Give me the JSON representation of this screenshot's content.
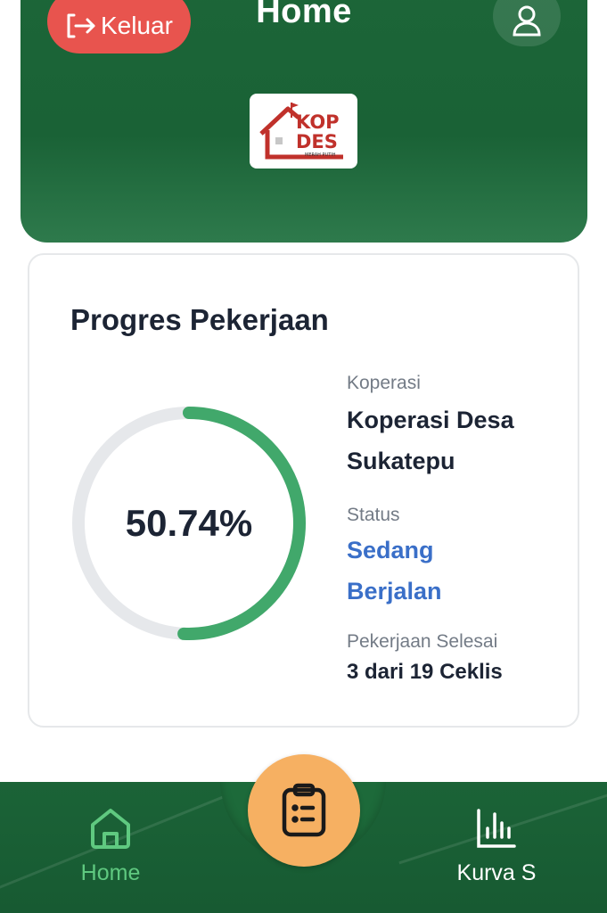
{
  "header": {
    "title": "Home",
    "logout_label": "Keluar",
    "logo": {
      "line1": "KOP",
      "line2": "DES",
      "tagline": "MERAH PUTIH"
    },
    "colors": {
      "background": "#1c6638",
      "logout": "#e8544e"
    }
  },
  "progress_card": {
    "title": "Progres Pekerjaan",
    "percent": 50.74,
    "percent_label": "50.74%",
    "koperasi_label": "Koperasi",
    "koperasi_value_line1": "Koperasi Desa",
    "koperasi_value_line2": "Sukatepu",
    "status_label": "Status",
    "status_value_line1": "Sedang",
    "status_value_line2": "Berjalan",
    "completed_label": "Pekerjaan Selesai",
    "completed_value": "3 dari 19 Ceklis",
    "colors": {
      "ring_fill": "#41a86b",
      "ring_track": "#e6e8eb",
      "status": "#3a6fc8"
    }
  },
  "bottom_nav": {
    "items": [
      {
        "label": "Home",
        "icon": "home-icon",
        "active": true
      },
      {
        "label": "Kurva S",
        "icon": "bar-chart-icon",
        "active": false
      }
    ],
    "center_button_icon": "clipboard-list-icon",
    "colors": {
      "active": "#5fc980",
      "fab": "#f6b062"
    }
  }
}
